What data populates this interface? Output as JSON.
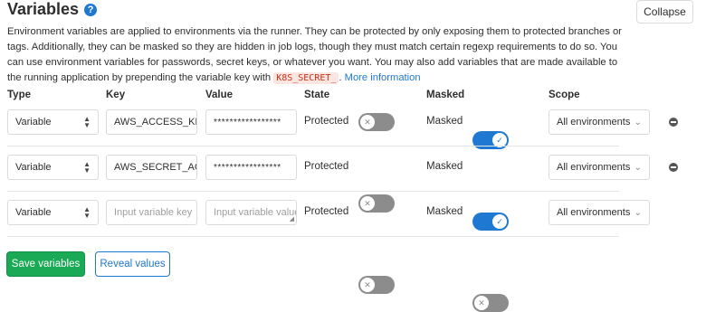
{
  "header": {
    "title": "Variables",
    "collapse_label": "Collapse"
  },
  "description": {
    "text_before_code": "Environment variables are applied to environments via the runner. They can be protected by only exposing them to protected branches or tags. Additionally, they can be masked so they are hidden in job logs, though they must match certain regexp requirements to do so. You can use environment variables for passwords, secret keys, or whatever you want. You may also add variables that are made available to the running application by prepending the variable key with ",
    "code": "K8S_SECRET_",
    "text_after_code": ". ",
    "link": "More information"
  },
  "columns": {
    "type": "Type",
    "key": "Key",
    "value": "Value",
    "state": "State",
    "masked": "Masked",
    "scope": "Scope"
  },
  "rows": [
    {
      "type": "Variable",
      "key": "AWS_ACCESS_KE",
      "value": "*****************",
      "state_label": "Protected",
      "protected_on": false,
      "masked_label": "Masked",
      "masked_on": true,
      "scope": "All environments",
      "removable": true
    },
    {
      "type": "Variable",
      "key": "AWS_SECRET_AC",
      "value": "*****************",
      "state_label": "Protected",
      "protected_on": false,
      "masked_label": "Masked",
      "masked_on": true,
      "scope": "All environments",
      "removable": true
    },
    {
      "type": "Variable",
      "key_placeholder": "Input variable key",
      "value_placeholder": "Input variable value",
      "state_label": "Protected",
      "protected_on": false,
      "masked_label": "Masked",
      "masked_on": false,
      "scope": "All environments",
      "removable": false
    }
  ],
  "footer": {
    "save_label": "Save variables",
    "reveal_label": "Reveal values"
  },
  "colors": {
    "primary_blue": "#1f78d1",
    "save_green": "#1aaa55",
    "toggle_off": "#8c8c8c"
  }
}
